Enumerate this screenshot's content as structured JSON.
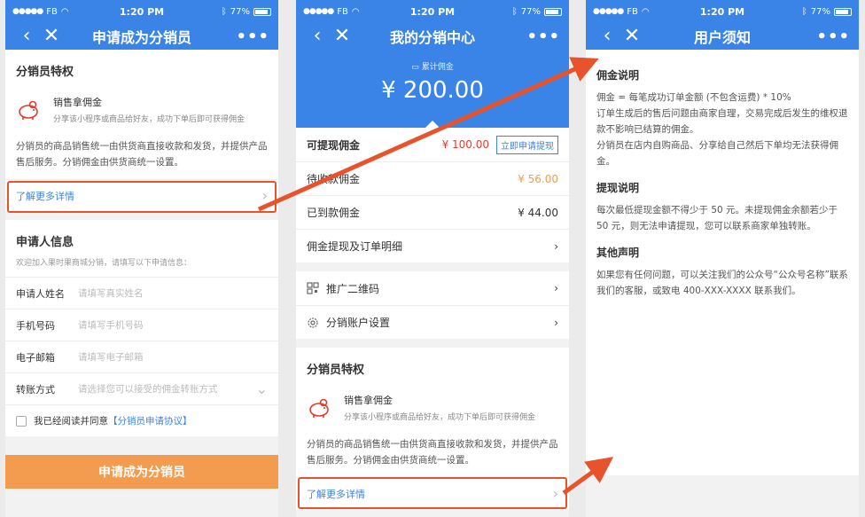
{
  "status": {
    "carrier": "FB",
    "time": "1:20 PM",
    "battery": "77%"
  },
  "screen1": {
    "title": "申请成为分销员",
    "perks_title": "分销员特权",
    "feature_title": "销售拿佣金",
    "feature_desc": "分享该小程序或商品给好友，成功下单后即可获得佣金",
    "paragraph": "分销员的商品销售统一由供货商直接收款和发货，并提供产品售后服务。分销佣金由供货商统一设置。",
    "more_link": "了解更多详情",
    "applicant_title": "申请人信息",
    "applicant_hint": "欢迎加入果时果商城分销，请填写以下申请信息：",
    "fields": [
      {
        "label": "申请人姓名",
        "placeholder": "请填写真实姓名"
      },
      {
        "label": "手机号码",
        "placeholder": "请填写手机号码"
      },
      {
        "label": "电子邮箱",
        "placeholder": "请填写电子邮箱"
      },
      {
        "label": "转账方式",
        "placeholder": "请选择您可以接受的佣金转账方式"
      }
    ],
    "agree_text": "我已经阅读并同意",
    "agree_link": "【分销员申请协议】",
    "apply_button": "申请成为分销员"
  },
  "screen2": {
    "title": "我的分销中心",
    "cumulative_label": "累计佣金",
    "cumulative_amount": "¥ 200.00",
    "rows": [
      {
        "label": "可提现佣金",
        "value": "¥ 100.00"
      },
      {
        "label": "待收款佣金",
        "value": "¥ 56.00"
      },
      {
        "label": "已到款佣金",
        "value": "¥ 44.00"
      },
      {
        "label": "佣金提现及订单明细",
        "value": ""
      }
    ],
    "withdraw_button": "立即申请提现",
    "qr_label": "推广二维码",
    "settings_label": "分销账户设置",
    "perks_title": "分销员特权",
    "feature_title": "销售拿佣金",
    "feature_desc": "分享该小程序或商品给好友，成功下单后即可获得佣金",
    "paragraph": "分销员的商品销售统一由供货商直接收款和发货，并提供产品售后服务。分销佣金由供货商统一设置。",
    "more_link": "了解更多详情"
  },
  "screen3": {
    "title": "用户须知",
    "sections": [
      {
        "heading": "佣金说明",
        "lines": [
          "佣金 = 每笔成功订单金额 (不包含运费) * 10%",
          "订单生成后的售后问题由商家自理，交易完成后发生的维权退款不影响已结算的佣金。",
          "分销员在店内自购商品、分享给自己然后下单均无法获得佣金。"
        ]
      },
      {
        "heading": "提现说明",
        "lines": [
          "每次最低提现金额不得少于 50 元。未提现佣金余额若少于 50 元，则无法申请提现，您可以联系商家单独转账。"
        ]
      },
      {
        "heading": "其他声明",
        "lines": [
          "如果您有任何问题，可以关注我们的公众号“公众号名称”联系我们的客服，或致电 400-XXX-XXXX 联系我们。"
        ]
      }
    ]
  },
  "colors": {
    "blue": "#3a84e8",
    "orange": "#f39b4e",
    "red": "#e8392e",
    "arrow": "#e8532c"
  },
  "icons": [
    "back-icon",
    "close-icon",
    "more-icon",
    "piggy-bank-icon",
    "qr-code-icon",
    "settings-icon",
    "chevron-right-icon",
    "chevron-down-icon",
    "wallet-icon"
  ]
}
